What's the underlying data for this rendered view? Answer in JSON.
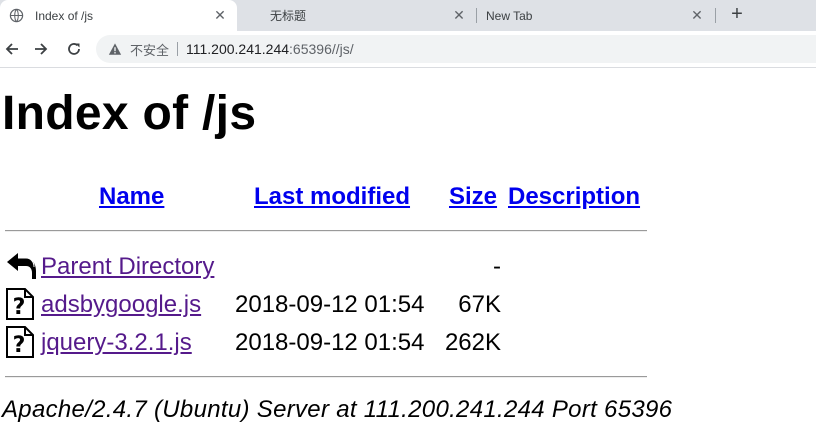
{
  "browser": {
    "tabs": [
      {
        "title": "Index of /js",
        "active": true
      },
      {
        "title": "无标题",
        "active": false
      },
      {
        "title": "New Tab",
        "active": false
      }
    ],
    "new_tab_label": "+",
    "address_bar": {
      "security_text": "不安全",
      "url_host": "111.200.241.244",
      "url_rest": ":65396//js/"
    }
  },
  "page": {
    "heading": "Index of /js",
    "columns": {
      "name": "Name",
      "last_modified": "Last modified",
      "size": "Size",
      "description": "Description"
    },
    "parent": {
      "name": "Parent Directory",
      "size": "-"
    },
    "files": [
      {
        "name": "adsbygoogle.js",
        "modified": "2018-09-12 01:54",
        "size": "67K",
        "icon": "unknown-file-icon"
      },
      {
        "name": "jquery-3.2.1.js",
        "modified": "2018-09-12 01:54",
        "size": "262K",
        "icon": "unknown-file-icon"
      }
    ],
    "footer": "Apache/2.4.7 (Ubuntu) Server at 111.200.241.244 Port 65396"
  },
  "colors": {
    "tabstrip": "#dee1e6",
    "link": "#0000ee",
    "visited_link": "#551a8b"
  }
}
